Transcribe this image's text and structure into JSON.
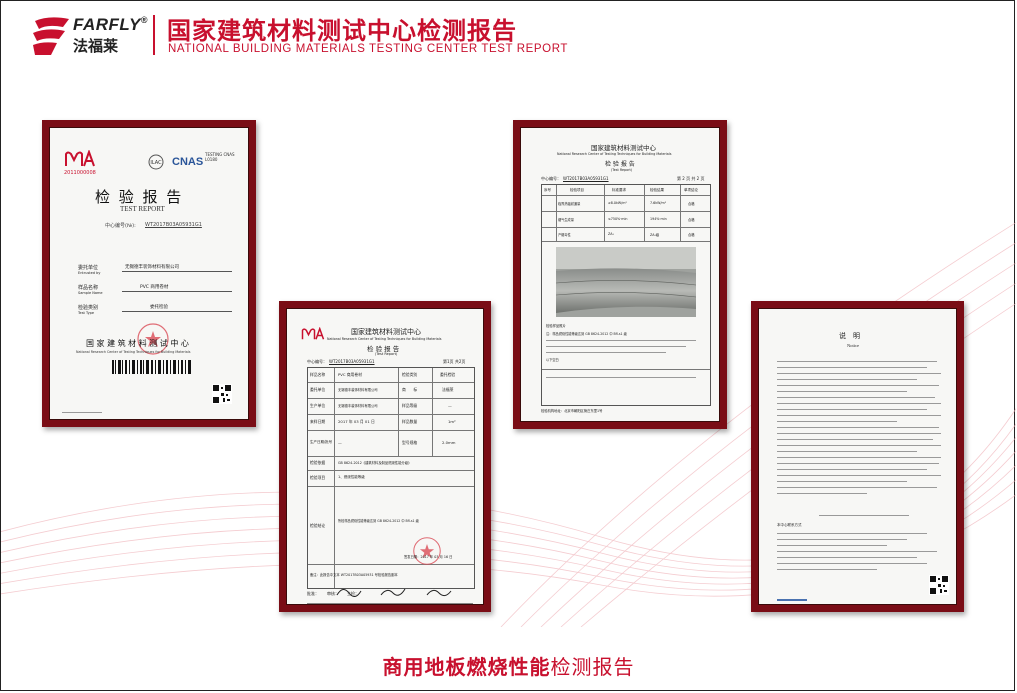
{
  "brand": {
    "name": "FARFLY",
    "reg_mark": "®",
    "name_cn": "法福莱"
  },
  "header": {
    "title_cn": "国家建筑材料测试中心检测报告",
    "title_en": "NATIONAL BUILDING MATERIALS TESTING CENTER TEST REPORT"
  },
  "doc1": {
    "ma": "MA",
    "cert_no": "2011000008",
    "ilac": "ILAC-MRA",
    "cnas": "CNAS",
    "cnas_sub": "TESTING CNAS L0180",
    "title": "检 验 报 告",
    "title_en": "TEST REPORT",
    "report_no_label": "中心编号(№):",
    "report_no": "WT2017B03A05931G1",
    "fields": [
      {
        "label": "委托单位",
        "label_en": "Entrusted by",
        "value": "无锡德丰装饰材料有限公司"
      },
      {
        "label": "样品名称",
        "label_en": "Sample Name",
        "value": "PVC 商用卷材"
      },
      {
        "label": "检验类别",
        "label_en": "Test Type",
        "value": "委托检验"
      }
    ],
    "org_cn": "国 家 建 筑 材 料 测 试 中 心",
    "org_en": "National Research Center of Testing Techniques for Building Materials"
  },
  "doc2": {
    "ma": "MA",
    "org_cn": "国家建筑材料测试中心",
    "org_en": "National Research Center of Testing Techniques for Building Materials",
    "title": "检 验 报 告",
    "title_en": "(Test Report)",
    "report_no_label": "中心编号：",
    "report_no": "WT2017B03A05931G1",
    "page": "第1页 共2页",
    "rows": [
      {
        "a": "样品名称",
        "b": "PVC 商用卷材",
        "c": "检验类别",
        "d": "委托检验"
      },
      {
        "a": "委托单位",
        "b": "无锡德丰装饰材料有限公司",
        "c": "商　　标",
        "d": "法福莱"
      },
      {
        "a": "生产单位",
        "b": "无锡德丰装饰材料有限公司",
        "c": "样品等级",
        "d": "—"
      },
      {
        "a": "来样日期",
        "b": "2017 年 03 月 01 日",
        "c": "样品数量",
        "d": "1m²"
      },
      {
        "a": "生产日期/批号",
        "b": "—",
        "c": "型号规格",
        "d": "2.0mm"
      },
      {
        "a": "检验依据",
        "b": "GB 8624-2012《建筑材料及制品燃烧性能分级》",
        "c": "",
        "d": ""
      },
      {
        "a": "检验项目",
        "b": "1、燃烧性能等级",
        "c": "",
        "d": ""
      },
      {
        "a": "检验结论",
        "b": "所检样品燃烧性能等级达到 GB 8624-2012 中 Bfl-s1 级",
        "c": "",
        "d": ""
      }
    ],
    "remark": "备注：此报告中文本 WT2017B03A05931 号检验报告副本",
    "footer": "批准：　　审核：　　主检：",
    "date": "签发日期：2017 年 03 月 16 日"
  },
  "doc3": {
    "org_cn": "国家建筑材料测试中心",
    "org_en": "National Research Center of Testing Techniques for Building Materials",
    "title": "检 验 报 告",
    "title_en": "(Test Report)",
    "report_no_label": "中心编号：",
    "report_no": "WT2017B03A05931G1",
    "page": "第 2 页 共 2 页",
    "headers": [
      "序号",
      "检验项目",
      "标准要求",
      "检验结果",
      "单项结论"
    ],
    "rows": [
      {
        "b": "临界热辐射通量",
        "c": "≥8.0kW/m²",
        "d": "7.6kW/m²",
        "e": "合格"
      },
      {
        "b": "烟气生成量",
        "c": "≤750%·min",
        "d": "194%·min",
        "e": "合格"
      },
      {
        "b": "产烟毒性",
        "c": "ZA₁",
        "d": "ZA₁级",
        "e": "合格"
      }
    ],
    "photo_caption": "检验样品照片",
    "notes": [
      "注：样品燃烧性能等级达到 GB 8624-2012 中 Bfl-s1 级",
      "以下空白"
    ],
    "address": "检验机构地址：北京市朝阳区管庄东里1号"
  },
  "doc4": {
    "title": "说　明",
    "title_en": "Notice",
    "contact_label": "本中心联系方式"
  },
  "footer": {
    "bold": "商用地板燃烧性能",
    "light": "检测报告"
  },
  "colors": {
    "accent": "#c8102e",
    "frame": "#7a0d16"
  }
}
